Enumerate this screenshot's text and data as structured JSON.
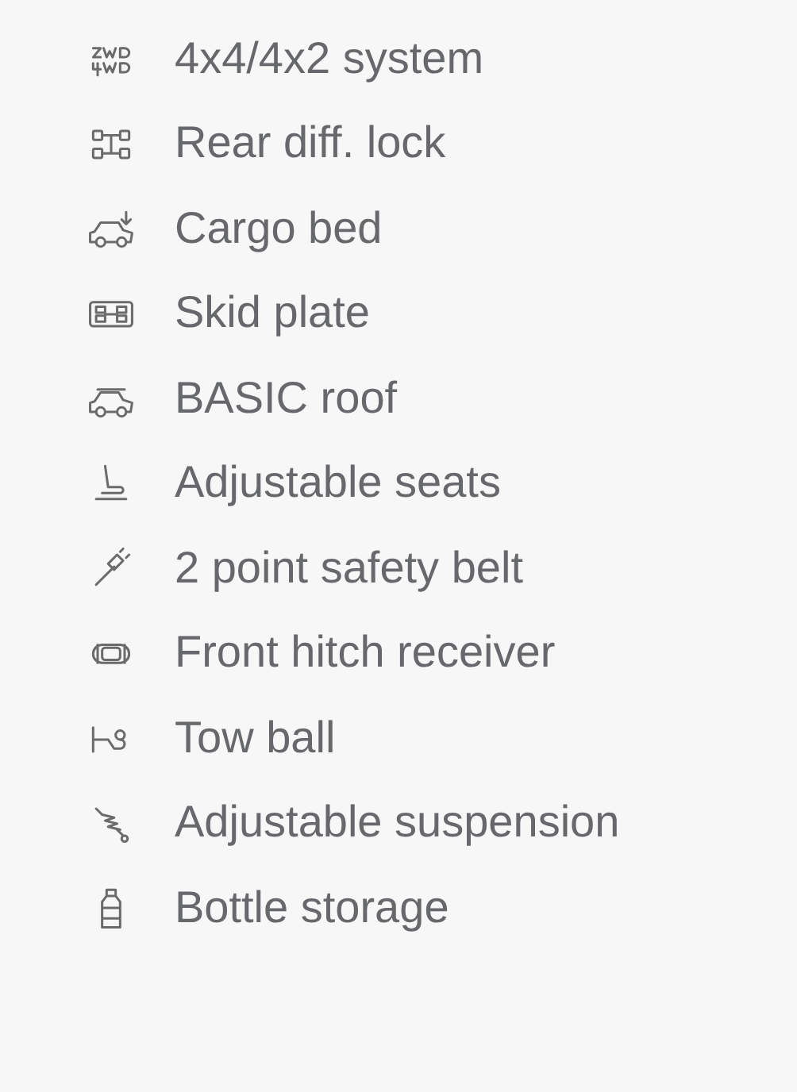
{
  "features": [
    {
      "label": "4x4/4x2 system"
    },
    {
      "label": "Rear diff. lock"
    },
    {
      "label": "Cargo bed"
    },
    {
      "label": "Skid plate"
    },
    {
      "label": "BASIC roof"
    },
    {
      "label": "Adjustable seats"
    },
    {
      "label": "2 point safety belt"
    },
    {
      "label": "Front hitch receiver"
    },
    {
      "label": "Tow ball"
    },
    {
      "label": "Adjustable suspension"
    },
    {
      "label": "Bottle storage"
    }
  ]
}
